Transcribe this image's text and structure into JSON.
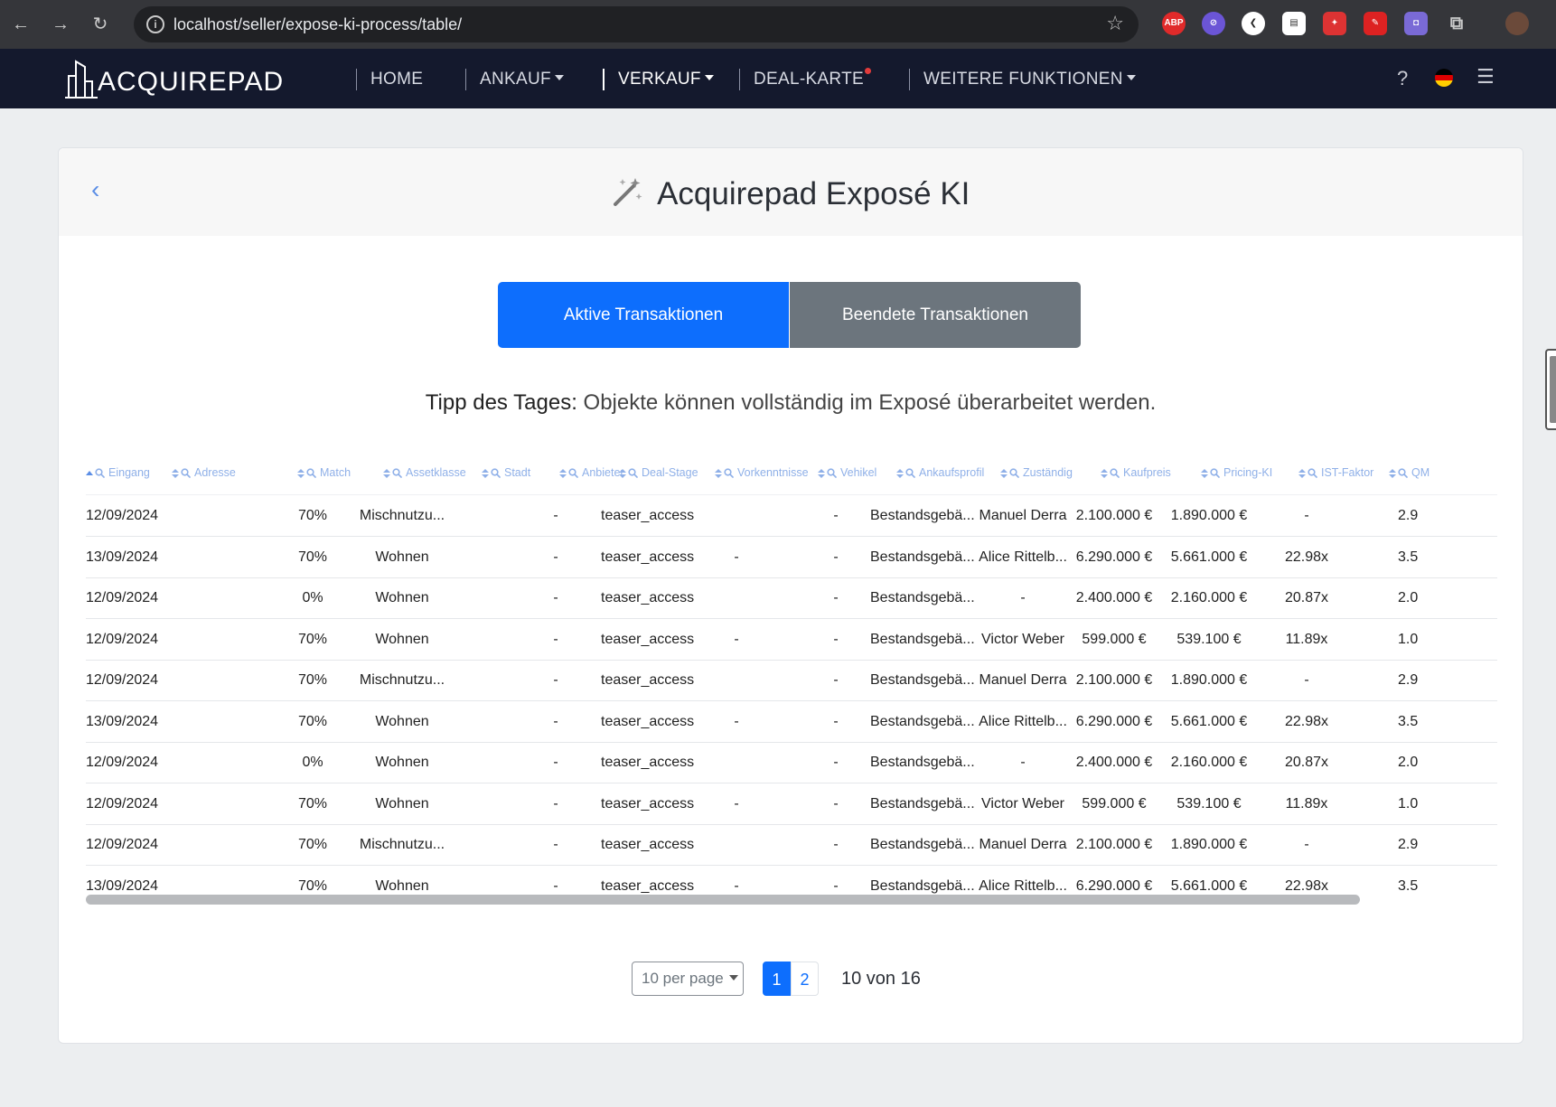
{
  "browser": {
    "url": "localhost/seller/expose-ki-process/table/",
    "extensions": [
      "ABP"
    ]
  },
  "navbar": {
    "logo": "ACQUIREPAD",
    "items": [
      {
        "label": "HOME"
      },
      {
        "label": "ANKAUF"
      },
      {
        "label": "VERKAUF"
      },
      {
        "label": "DEAL-KARTE"
      },
      {
        "label": "WEITERE FUNKTIONEN"
      }
    ],
    "help": "?"
  },
  "page": {
    "title": "Acquirepad Exposé KI",
    "tab_active": "Aktive Transaktionen",
    "tab_inactive": "Beendete Transaktionen",
    "tip_label": "Tipp des Tages:",
    "tip_text": "Objekte können vollständig im Exposé überarbeitet werden."
  },
  "table": {
    "columns": [
      "Eingang",
      "Adresse",
      "Match",
      "Assetklasse",
      "Stadt",
      "Anbieter",
      "Deal-Stage",
      "Vorkenntnisse",
      "Vehikel",
      "Ankaufsprofil",
      "Zuständig",
      "Kaufpreis",
      "Pricing-KI",
      "IST-Faktor",
      "QM"
    ],
    "rows": [
      {
        "eingang": "12/09/2024",
        "match": "70%",
        "asset": "Mischnutzu...",
        "anbieter": "-",
        "stage": "teaser_access",
        "vork": "",
        "vehikel": "-",
        "profil": "Bestandsgebä...",
        "zust": "Manuel Derra",
        "kaufpreis": "2.100.000 €",
        "pricing": "1.890.000 €",
        "ist": "-",
        "qm": "2.9"
      },
      {
        "eingang": "13/09/2024",
        "match": "70%",
        "asset": "Wohnen",
        "anbieter": "-",
        "stage": "teaser_access",
        "vork": "-",
        "vehikel": "-",
        "profil": "Bestandsgebä...",
        "zust": "Alice Rittelb...",
        "kaufpreis": "6.290.000 €",
        "pricing": "5.661.000 €",
        "ist": "22.98x",
        "qm": "3.5"
      },
      {
        "eingang": "12/09/2024",
        "match": "0%",
        "asset": "Wohnen",
        "anbieter": "-",
        "stage": "teaser_access",
        "vork": "",
        "vehikel": "-",
        "profil": "Bestandsgebä...",
        "zust": "-",
        "kaufpreis": "2.400.000 €",
        "pricing": "2.160.000 €",
        "ist": "20.87x",
        "qm": "2.0"
      },
      {
        "eingang": "12/09/2024",
        "match": "70%",
        "asset": "Wohnen",
        "anbieter": "-",
        "stage": "teaser_access",
        "vork": "-",
        "vehikel": "-",
        "profil": "Bestandsgebä...",
        "zust": "Victor Weber",
        "kaufpreis": "599.000 €",
        "pricing": "539.100 €",
        "ist": "11.89x",
        "qm": "1.0"
      },
      {
        "eingang": "12/09/2024",
        "match": "70%",
        "asset": "Mischnutzu...",
        "anbieter": "-",
        "stage": "teaser_access",
        "vork": "",
        "vehikel": "-",
        "profil": "Bestandsgebä...",
        "zust": "Manuel Derra",
        "kaufpreis": "2.100.000 €",
        "pricing": "1.890.000 €",
        "ist": "-",
        "qm": "2.9"
      },
      {
        "eingang": "13/09/2024",
        "match": "70%",
        "asset": "Wohnen",
        "anbieter": "-",
        "stage": "teaser_access",
        "vork": "-",
        "vehikel": "-",
        "profil": "Bestandsgebä...",
        "zust": "Alice Rittelb...",
        "kaufpreis": "6.290.000 €",
        "pricing": "5.661.000 €",
        "ist": "22.98x",
        "qm": "3.5"
      },
      {
        "eingang": "12/09/2024",
        "match": "0%",
        "asset": "Wohnen",
        "anbieter": "-",
        "stage": "teaser_access",
        "vork": "",
        "vehikel": "-",
        "profil": "Bestandsgebä...",
        "zust": "-",
        "kaufpreis": "2.400.000 €",
        "pricing": "2.160.000 €",
        "ist": "20.87x",
        "qm": "2.0"
      },
      {
        "eingang": "12/09/2024",
        "match": "70%",
        "asset": "Wohnen",
        "anbieter": "-",
        "stage": "teaser_access",
        "vork": "-",
        "vehikel": "-",
        "profil": "Bestandsgebä...",
        "zust": "Victor Weber",
        "kaufpreis": "599.000 €",
        "pricing": "539.100 €",
        "ist": "11.89x",
        "qm": "1.0"
      },
      {
        "eingang": "12/09/2024",
        "match": "70%",
        "asset": "Mischnutzu...",
        "anbieter": "-",
        "stage": "teaser_access",
        "vork": "",
        "vehikel": "-",
        "profil": "Bestandsgebä...",
        "zust": "Manuel Derra",
        "kaufpreis": "2.100.000 €",
        "pricing": "1.890.000 €",
        "ist": "-",
        "qm": "2.9"
      },
      {
        "eingang": "13/09/2024",
        "match": "70%",
        "asset": "Wohnen",
        "anbieter": "-",
        "stage": "teaser_access",
        "vork": "-",
        "vehikel": "-",
        "profil": "Bestandsgebä...",
        "zust": "Alice Rittelb...",
        "kaufpreis": "6.290.000 €",
        "pricing": "5.661.000 €",
        "ist": "22.98x",
        "qm": "3.5"
      }
    ]
  },
  "pagination": {
    "per_page": "10 per page",
    "pages": [
      "1",
      "2"
    ],
    "count": "10 von 16"
  },
  "colors": {
    "navbar": "#14192d",
    "primary": "#0d6efd",
    "secondary": "#6c757d",
    "header_link": "#8fb0e8"
  }
}
